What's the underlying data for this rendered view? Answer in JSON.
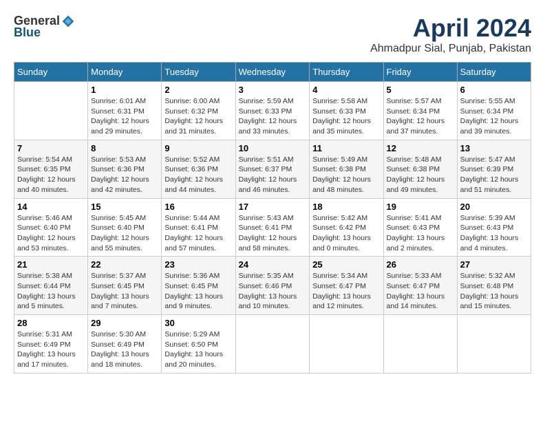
{
  "header": {
    "logo_general": "General",
    "logo_blue": "Blue",
    "title": "April 2024",
    "subtitle": "Ahmadpur Sial, Punjab, Pakistan"
  },
  "days_of_week": [
    "Sunday",
    "Monday",
    "Tuesday",
    "Wednesday",
    "Thursday",
    "Friday",
    "Saturday"
  ],
  "weeks": [
    [
      {
        "day": "",
        "sunrise": "",
        "sunset": "",
        "daylight": ""
      },
      {
        "day": "1",
        "sunrise": "Sunrise: 6:01 AM",
        "sunset": "Sunset: 6:31 PM",
        "daylight": "Daylight: 12 hours and 29 minutes."
      },
      {
        "day": "2",
        "sunrise": "Sunrise: 6:00 AM",
        "sunset": "Sunset: 6:32 PM",
        "daylight": "Daylight: 12 hours and 31 minutes."
      },
      {
        "day": "3",
        "sunrise": "Sunrise: 5:59 AM",
        "sunset": "Sunset: 6:33 PM",
        "daylight": "Daylight: 12 hours and 33 minutes."
      },
      {
        "day": "4",
        "sunrise": "Sunrise: 5:58 AM",
        "sunset": "Sunset: 6:33 PM",
        "daylight": "Daylight: 12 hours and 35 minutes."
      },
      {
        "day": "5",
        "sunrise": "Sunrise: 5:57 AM",
        "sunset": "Sunset: 6:34 PM",
        "daylight": "Daylight: 12 hours and 37 minutes."
      },
      {
        "day": "6",
        "sunrise": "Sunrise: 5:55 AM",
        "sunset": "Sunset: 6:34 PM",
        "daylight": "Daylight: 12 hours and 39 minutes."
      }
    ],
    [
      {
        "day": "7",
        "sunrise": "Sunrise: 5:54 AM",
        "sunset": "Sunset: 6:35 PM",
        "daylight": "Daylight: 12 hours and 40 minutes."
      },
      {
        "day": "8",
        "sunrise": "Sunrise: 5:53 AM",
        "sunset": "Sunset: 6:36 PM",
        "daylight": "Daylight: 12 hours and 42 minutes."
      },
      {
        "day": "9",
        "sunrise": "Sunrise: 5:52 AM",
        "sunset": "Sunset: 6:36 PM",
        "daylight": "Daylight: 12 hours and 44 minutes."
      },
      {
        "day": "10",
        "sunrise": "Sunrise: 5:51 AM",
        "sunset": "Sunset: 6:37 PM",
        "daylight": "Daylight: 12 hours and 46 minutes."
      },
      {
        "day": "11",
        "sunrise": "Sunrise: 5:49 AM",
        "sunset": "Sunset: 6:38 PM",
        "daylight": "Daylight: 12 hours and 48 minutes."
      },
      {
        "day": "12",
        "sunrise": "Sunrise: 5:48 AM",
        "sunset": "Sunset: 6:38 PM",
        "daylight": "Daylight: 12 hours and 49 minutes."
      },
      {
        "day": "13",
        "sunrise": "Sunrise: 5:47 AM",
        "sunset": "Sunset: 6:39 PM",
        "daylight": "Daylight: 12 hours and 51 minutes."
      }
    ],
    [
      {
        "day": "14",
        "sunrise": "Sunrise: 5:46 AM",
        "sunset": "Sunset: 6:40 PM",
        "daylight": "Daylight: 12 hours and 53 minutes."
      },
      {
        "day": "15",
        "sunrise": "Sunrise: 5:45 AM",
        "sunset": "Sunset: 6:40 PM",
        "daylight": "Daylight: 12 hours and 55 minutes."
      },
      {
        "day": "16",
        "sunrise": "Sunrise: 5:44 AM",
        "sunset": "Sunset: 6:41 PM",
        "daylight": "Daylight: 12 hours and 57 minutes."
      },
      {
        "day": "17",
        "sunrise": "Sunrise: 5:43 AM",
        "sunset": "Sunset: 6:41 PM",
        "daylight": "Daylight: 12 hours and 58 minutes."
      },
      {
        "day": "18",
        "sunrise": "Sunrise: 5:42 AM",
        "sunset": "Sunset: 6:42 PM",
        "daylight": "Daylight: 13 hours and 0 minutes."
      },
      {
        "day": "19",
        "sunrise": "Sunrise: 5:41 AM",
        "sunset": "Sunset: 6:43 PM",
        "daylight": "Daylight: 13 hours and 2 minutes."
      },
      {
        "day": "20",
        "sunrise": "Sunrise: 5:39 AM",
        "sunset": "Sunset: 6:43 PM",
        "daylight": "Daylight: 13 hours and 4 minutes."
      }
    ],
    [
      {
        "day": "21",
        "sunrise": "Sunrise: 5:38 AM",
        "sunset": "Sunset: 6:44 PM",
        "daylight": "Daylight: 13 hours and 5 minutes."
      },
      {
        "day": "22",
        "sunrise": "Sunrise: 5:37 AM",
        "sunset": "Sunset: 6:45 PM",
        "daylight": "Daylight: 13 hours and 7 minutes."
      },
      {
        "day": "23",
        "sunrise": "Sunrise: 5:36 AM",
        "sunset": "Sunset: 6:45 PM",
        "daylight": "Daylight: 13 hours and 9 minutes."
      },
      {
        "day": "24",
        "sunrise": "Sunrise: 5:35 AM",
        "sunset": "Sunset: 6:46 PM",
        "daylight": "Daylight: 13 hours and 10 minutes."
      },
      {
        "day": "25",
        "sunrise": "Sunrise: 5:34 AM",
        "sunset": "Sunset: 6:47 PM",
        "daylight": "Daylight: 13 hours and 12 minutes."
      },
      {
        "day": "26",
        "sunrise": "Sunrise: 5:33 AM",
        "sunset": "Sunset: 6:47 PM",
        "daylight": "Daylight: 13 hours and 14 minutes."
      },
      {
        "day": "27",
        "sunrise": "Sunrise: 5:32 AM",
        "sunset": "Sunset: 6:48 PM",
        "daylight": "Daylight: 13 hours and 15 minutes."
      }
    ],
    [
      {
        "day": "28",
        "sunrise": "Sunrise: 5:31 AM",
        "sunset": "Sunset: 6:49 PM",
        "daylight": "Daylight: 13 hours and 17 minutes."
      },
      {
        "day": "29",
        "sunrise": "Sunrise: 5:30 AM",
        "sunset": "Sunset: 6:49 PM",
        "daylight": "Daylight: 13 hours and 18 minutes."
      },
      {
        "day": "30",
        "sunrise": "Sunrise: 5:29 AM",
        "sunset": "Sunset: 6:50 PM",
        "daylight": "Daylight: 13 hours and 20 minutes."
      },
      {
        "day": "",
        "sunrise": "",
        "sunset": "",
        "daylight": ""
      },
      {
        "day": "",
        "sunrise": "",
        "sunset": "",
        "daylight": ""
      },
      {
        "day": "",
        "sunrise": "",
        "sunset": "",
        "daylight": ""
      },
      {
        "day": "",
        "sunrise": "",
        "sunset": "",
        "daylight": ""
      }
    ]
  ]
}
